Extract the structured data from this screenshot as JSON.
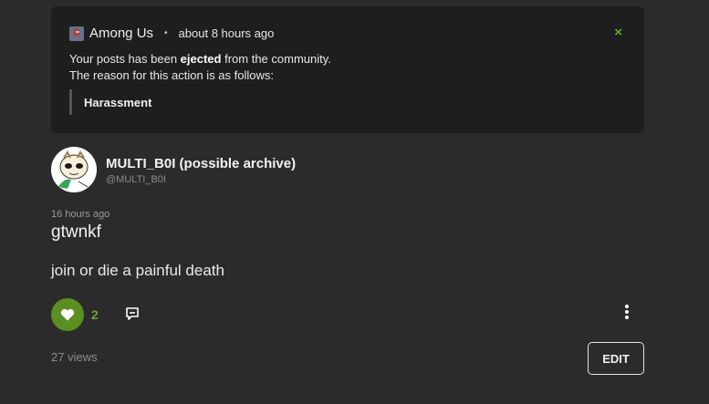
{
  "notice": {
    "community_name": "Among Us",
    "separator": "•",
    "time": "about 8 hours ago",
    "close_glyph": "×",
    "line1_prefix": "Your posts has been ",
    "line1_bold": "ejected",
    "line1_suffix": " from the community.",
    "line2": "The reason for this action is as follows:",
    "reason": "Harassment",
    "community_icon": "among-us-crewmate-icon",
    "close_color": "#6ea531"
  },
  "post": {
    "author_name": "MULTI_B0I (possible archive)",
    "author_handle": "@MULTI_B0I",
    "time": "16 hours ago",
    "title": "gtwnkf",
    "body": "join or die a painful death",
    "like_count": "2",
    "views": "27 views",
    "edit_label": "EDIT"
  },
  "colors": {
    "background": "#2b2b2b",
    "notice_bg": "#1e1e1e",
    "accent_green": "#5c8f22"
  },
  "icons": {
    "like": "heart-icon",
    "reply": "reply-bubble-icon",
    "more": "vertical-ellipsis-icon",
    "avatar": "cartoon-character-avatar"
  }
}
